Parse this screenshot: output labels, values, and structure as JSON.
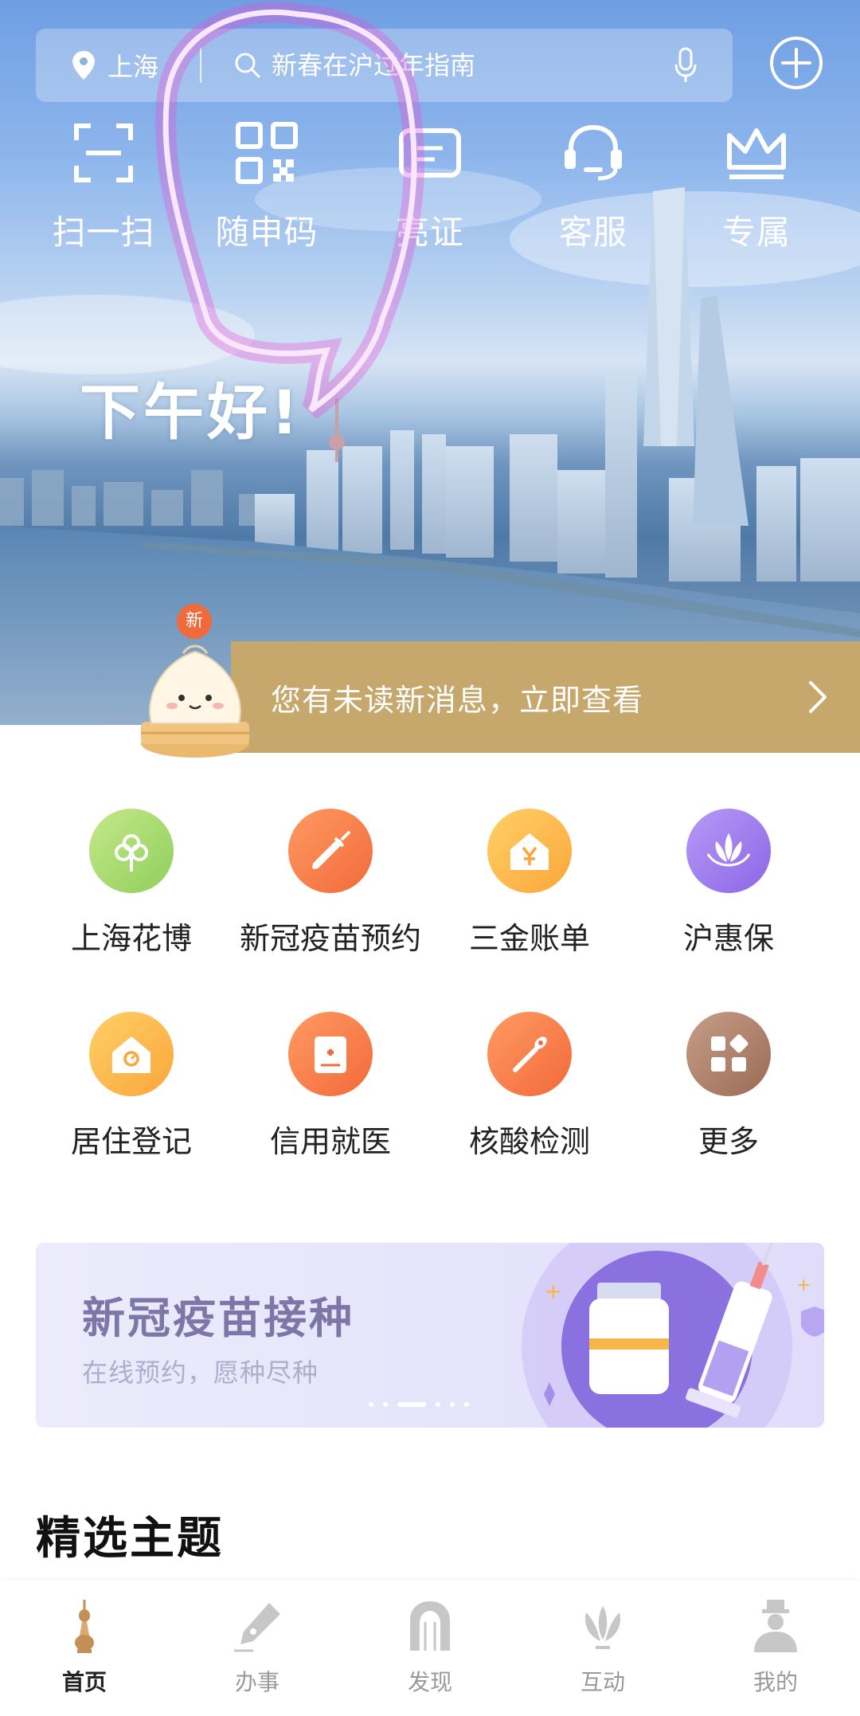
{
  "header": {
    "location": "上海",
    "search_placeholder": "新春在沪过年指南",
    "quick_actions": [
      {
        "label": "扫一扫",
        "icon": "scan-icon"
      },
      {
        "label": "随申码",
        "icon": "qr-code-icon"
      },
      {
        "label": "亮证",
        "icon": "id-card-icon"
      },
      {
        "label": "客服",
        "icon": "headset-icon"
      },
      {
        "label": "专属",
        "icon": "crown-icon"
      }
    ],
    "greeting": "下午好!"
  },
  "message_banner": {
    "badge": "新",
    "text": "您有未读新消息，立即查看"
  },
  "services": [
    {
      "label": "上海花博",
      "icon": "flower-expo-icon",
      "color": "#8fcf5c"
    },
    {
      "label": "新冠疫苗预约",
      "icon": "syringe-icon",
      "color": "#f26a3a"
    },
    {
      "label": "三金账单",
      "icon": "yen-house-icon",
      "color": "#fba63a"
    },
    {
      "label": "沪惠保",
      "icon": "lotus-icon",
      "color": "#8c66e6"
    },
    {
      "label": "居住登记",
      "icon": "home-register-icon",
      "color": "#fba63a"
    },
    {
      "label": "信用就医",
      "icon": "medical-card-icon",
      "color": "#f26a3a"
    },
    {
      "label": "核酸检测",
      "icon": "swab-test-icon",
      "color": "#f26a3a"
    },
    {
      "label": "更多",
      "icon": "more-grid-icon",
      "color": "#9a6b55"
    }
  ],
  "promo_banner": {
    "title": "新冠疫苗接种",
    "subtitle": "在线预约，愿种尽种",
    "slide_count": 6,
    "active_slide": 2
  },
  "section_title": "精选主题",
  "bottom_nav": [
    {
      "label": "首页",
      "icon": "home-tower-icon",
      "active": true
    },
    {
      "label": "办事",
      "icon": "pen-icon",
      "active": false
    },
    {
      "label": "发现",
      "icon": "discover-arch-icon",
      "active": false
    },
    {
      "label": "互动",
      "icon": "interact-lotus-icon",
      "active": false
    },
    {
      "label": "我的",
      "icon": "profile-icon",
      "active": false
    }
  ],
  "colors": {
    "banner_gold": "#c6a76c",
    "annotation_pink": "#e94fd6",
    "promo_text": "#7d76a6"
  }
}
